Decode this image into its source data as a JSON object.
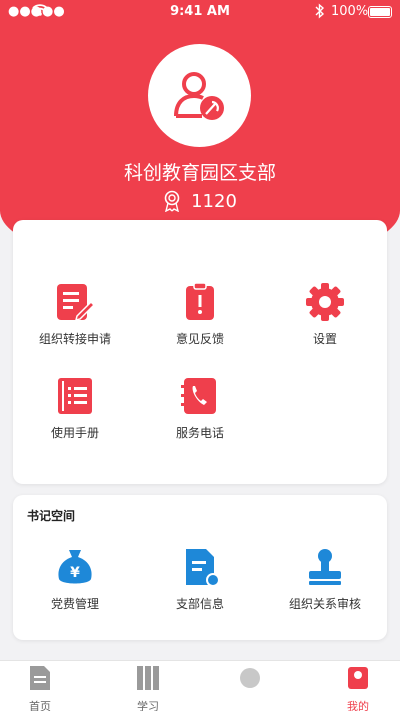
{
  "status_bar": {
    "time": "9:41 AM",
    "battery": "100%"
  },
  "profile": {
    "org_name": "科创教育园区支部",
    "points": "1120"
  },
  "main_menu": [
    {
      "label": "组织转接申请",
      "icon": "transfer-application-icon"
    },
    {
      "label": "意见反馈",
      "icon": "feedback-icon"
    },
    {
      "label": "设置",
      "icon": "gear-icon"
    },
    {
      "label": "使用手册",
      "icon": "manual-icon"
    },
    {
      "label": "服务电话",
      "icon": "phone-icon"
    }
  ],
  "secretary_section": {
    "title": "书记空间",
    "items": [
      {
        "label": "党费管理",
        "icon": "money-bag-icon"
      },
      {
        "label": "支部信息",
        "icon": "branch-info-icon"
      },
      {
        "label": "组织关系审核",
        "icon": "stamp-icon"
      }
    ]
  },
  "tabbar": {
    "tabs": [
      {
        "label": "首页",
        "active": false
      },
      {
        "label": "学习",
        "active": false
      },
      {
        "label": "",
        "active": false
      },
      {
        "label": "我的",
        "active": true
      }
    ]
  },
  "colors": {
    "primary": "#ef3f4c",
    "accent_blue": "#1e88d8",
    "background": "#f2f2f4"
  }
}
